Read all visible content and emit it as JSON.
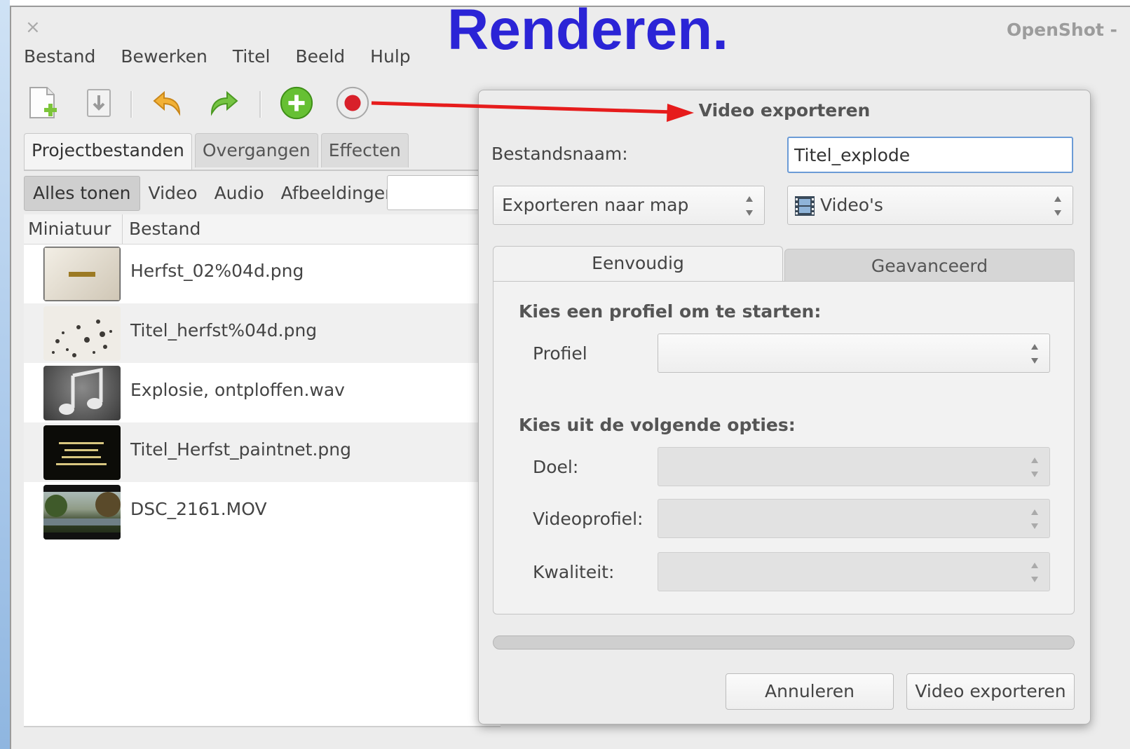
{
  "window": {
    "close_glyph": "×",
    "title": "OpenShot -"
  },
  "overlay_title": "Renderen.",
  "menu": [
    "Bestand",
    "Bewerken",
    "Titel",
    "Beeld",
    "Hulp"
  ],
  "toolbar": {
    "icons": [
      "new-project-icon",
      "import-icon",
      "undo-icon",
      "redo-icon",
      "add-icon",
      "record-icon"
    ]
  },
  "left_tabs": [
    "Projectbestanden",
    "Overgangen",
    "Effecten"
  ],
  "filters": [
    "Alles tonen",
    "Video",
    "Audio",
    "Afbeeldingen"
  ],
  "columns": [
    "Miniatuur",
    "Bestand"
  ],
  "files": [
    {
      "name": "Herfst_02%04d.png",
      "thumb": "herfst-title-thumb"
    },
    {
      "name": "Titel_herfst%04d.png",
      "thumb": "leaves-thumb"
    },
    {
      "name": "Explosie, ontploffen.wav",
      "thumb": "audio-note-thumb"
    },
    {
      "name": "Titel_Herfst_paintnet.png",
      "thumb": "dark-text-thumb"
    },
    {
      "name": "DSC_2161.MOV",
      "thumb": "landscape-thumb"
    }
  ],
  "dialog": {
    "title": "Video exporteren",
    "filename_label": "Bestandsnaam:",
    "filename_value": "Titel_explode",
    "export_to_folder": "Exporteren naar map",
    "folder_value": "Video's",
    "tabs": [
      "Eenvoudig",
      "Geavanceerd"
    ],
    "section_profile": "Kies een profiel om te starten:",
    "profile_label": "Profiel",
    "profile_value": "",
    "section_options": "Kies uit de volgende opties:",
    "target_label": "Doel:",
    "videoprofile_label": "Videoprofiel:",
    "quality_label": "Kwaliteit:",
    "progress": 0,
    "cancel_label": "Annuleren",
    "export_label": "Video exporteren"
  },
  "colors": {
    "overlay": "#2b24d6",
    "arrow": "#e61c1c",
    "add": "#5cb82e",
    "record": "#d8202a"
  }
}
